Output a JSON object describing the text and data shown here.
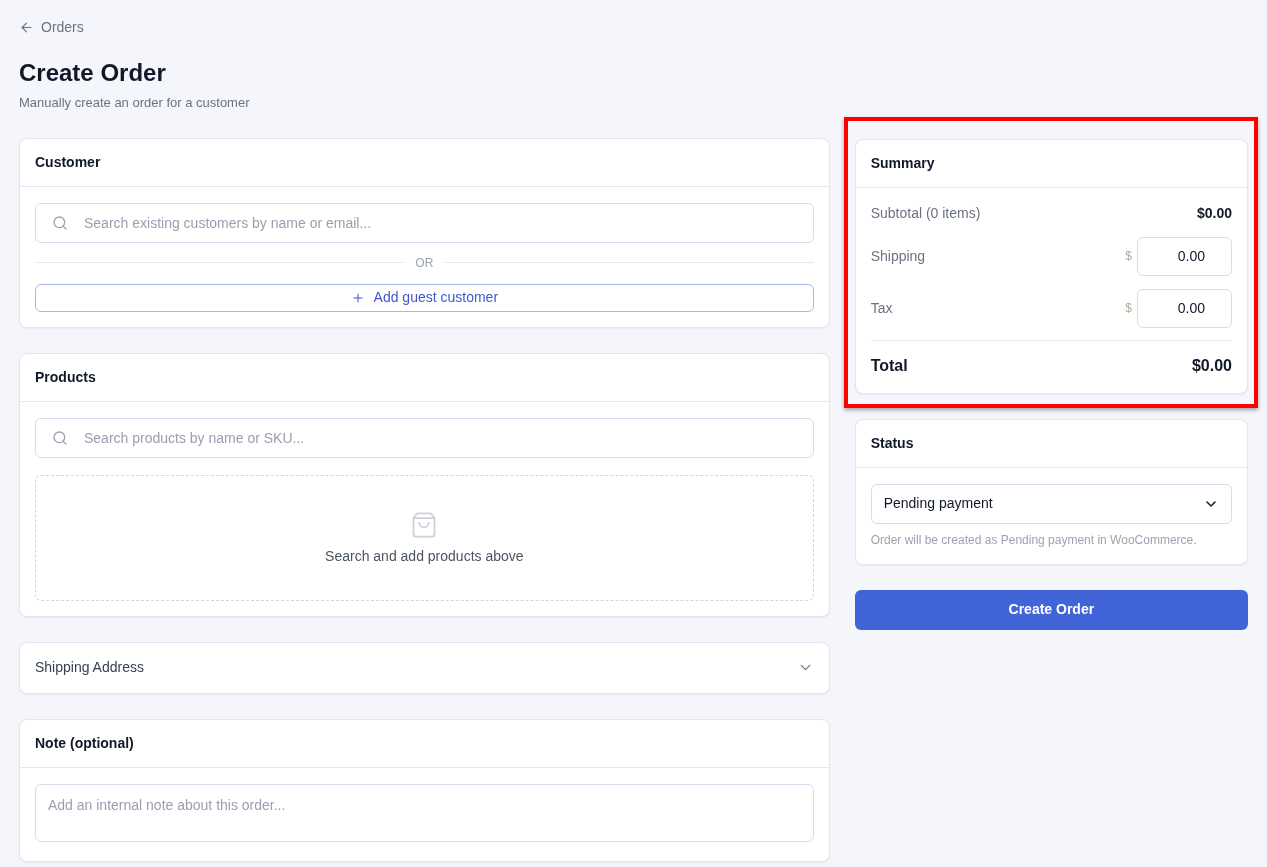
{
  "back_link": {
    "label": "Orders"
  },
  "header": {
    "title": "Create Order",
    "subtitle": "Manually create an order for a customer"
  },
  "customer": {
    "title": "Customer",
    "search": {
      "placeholder": "Search existing customers by name or email..."
    },
    "divider": "OR",
    "add_guest_button": "Add guest customer"
  },
  "products": {
    "title": "Products",
    "search": {
      "placeholder": "Search products by name or SKU..."
    },
    "empty_state": "Search and add products above"
  },
  "shipping_address": {
    "title": "Shipping Address",
    "expanded": false
  },
  "note": {
    "title": "Note (optional)",
    "placeholder": "Add an internal note about this order..."
  },
  "summary": {
    "title": "Summary",
    "highlighted": true,
    "rows": [
      {
        "kind": "text",
        "label": "Subtotal (0 items)",
        "value": "$0.00"
      },
      {
        "kind": "input",
        "label": "Shipping",
        "currency": "$",
        "value": "0.00"
      },
      {
        "kind": "input",
        "label": "Tax",
        "currency": "$",
        "value": "0.00"
      }
    ],
    "total": {
      "label": "Total",
      "value": "$0.00"
    }
  },
  "status": {
    "title": "Status",
    "select": {
      "value": "Pending payment"
    },
    "hint": "Order will be created as Pending payment in WooCommerce."
  },
  "primary_button": "Create Order"
}
